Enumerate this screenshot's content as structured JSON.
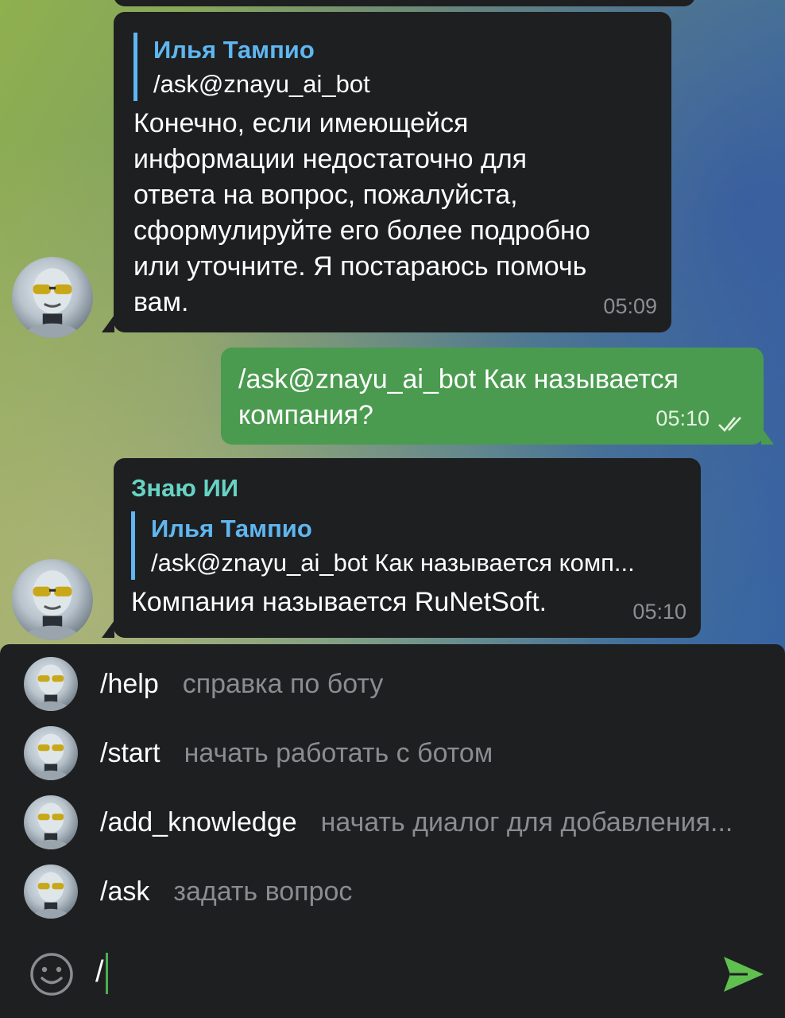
{
  "messages": [
    {
      "reply": {
        "name": "Илья Тампио",
        "text": "/ask@znayu_ai_bot"
      },
      "lines": [
        "Конечно, если имеющейся",
        "информации недостаточно для",
        "ответа на вопрос, пожалуйста,",
        "сформулируйте его более подробно",
        "или уточните. Я постараюсь помочь",
        "вам."
      ],
      "time": "05:09"
    },
    {
      "lines": [
        "/ask@znayu_ai_bot Как называется",
        "компания?"
      ],
      "time": "05:10",
      "status_icon": "double-check-icon"
    },
    {
      "sender": "Знаю ИИ",
      "reply": {
        "name": "Илья Тампио",
        "text": "/ask@znayu_ai_bot Как называется комп..."
      },
      "lines": [
        "Компания называется RuNetSoft."
      ],
      "time": "05:10"
    }
  ],
  "commands": [
    {
      "name": "/help",
      "description": "справка по боту"
    },
    {
      "name": "/start",
      "description": "начать работать с ботом"
    },
    {
      "name": "/add_knowledge",
      "description": "начать диалог для добавления..."
    },
    {
      "name": "/ask",
      "description": "задать вопрос"
    }
  ],
  "input": {
    "value": "/",
    "emoji_icon": "smiley-icon",
    "send_icon": "send-icon"
  },
  "colors": {
    "incoming_bubble": "#1e1f21",
    "outgoing_bubble": "#4a9b4f",
    "reply_accent": "#5fb6f0",
    "sender_name": "#67d3c4",
    "send_button": "#5fbf4f"
  }
}
